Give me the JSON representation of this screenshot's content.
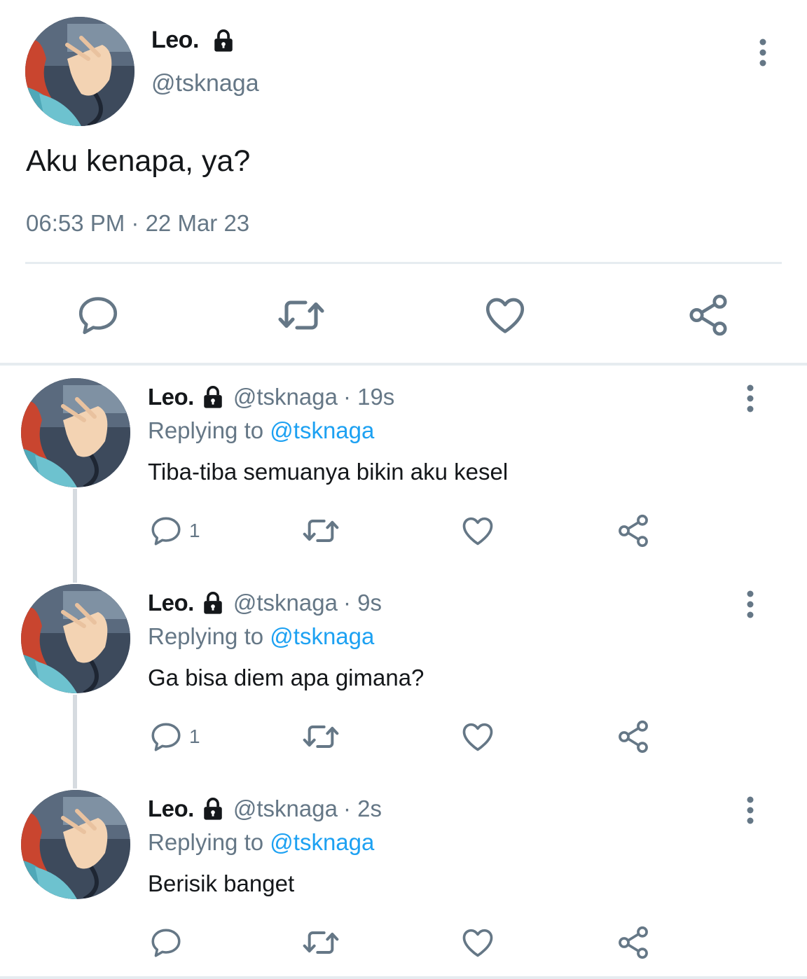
{
  "main_tweet": {
    "name": "Leo.",
    "handle": "@tsknaga",
    "text": "Aku kenapa, ya?",
    "timestamp": "06:53 PM · 22 Mar 23",
    "protected_icon": "lock-icon",
    "actions": [
      "reply-icon",
      "retweet-icon",
      "like-icon",
      "share-icon"
    ]
  },
  "replies": [
    {
      "name": "Leo.",
      "handle": "@tsknaga",
      "time": "· 19s",
      "replying_label": "Replying to",
      "replying_to": "@tsknaga",
      "text": "Tiba-tiba semuanya bikin aku kesel",
      "reply_count": "1"
    },
    {
      "name": "Leo.",
      "handle": "@tsknaga",
      "time": "· 9s",
      "replying_label": "Replying to",
      "replying_to": "@tsknaga",
      "text": "Ga bisa diem apa gimana?",
      "reply_count": "1"
    },
    {
      "name": "Leo.",
      "handle": "@tsknaga",
      "time": "· 2s",
      "replying_label": "Replying to",
      "replying_to": "@tsknaga",
      "text": "Berisik banget",
      "reply_count": ""
    }
  ],
  "colors": {
    "text": "#14171a",
    "secondary": "#657786",
    "link": "#1da1f2",
    "divider": "#e6ecf0"
  }
}
